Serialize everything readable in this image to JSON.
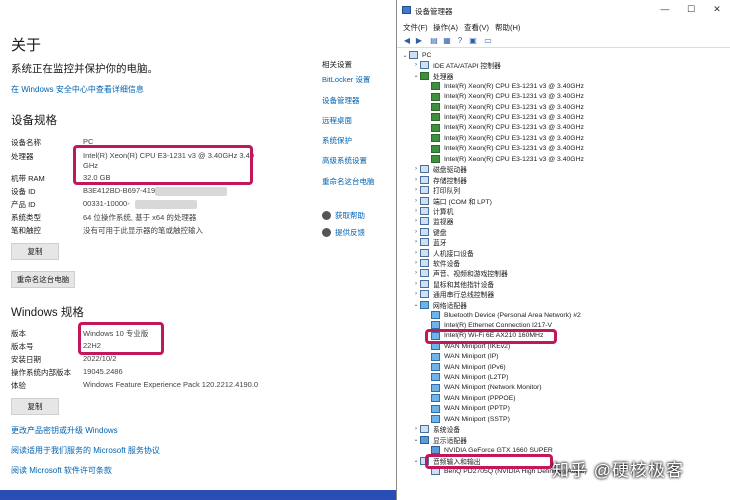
{
  "about": {
    "title": "关于",
    "subtitle": "系统正在监控并保护你的电脑。",
    "security_link": "在 Windows 安全中心中查看详细信息",
    "device_specs_heading": "设备规格",
    "device_specs": [
      {
        "key": "设备名称",
        "value": "PC"
      },
      {
        "key": "处理器",
        "value": "Intel(R) Xeon(R) CPU E3-1231 v3 @ 3.40GHz   3.40"
      },
      {
        "key": "",
        "value": "GHz"
      },
      {
        "key": "机带 RAM",
        "value": "32.0 GB"
      },
      {
        "key": "设备 ID",
        "value": "B3E412BD-B697-4197"
      },
      {
        "key": "产品 ID",
        "value": "00331-10000-"
      },
      {
        "key": "系统类型",
        "value": "64 位操作系统, 基于 x64 的处理器"
      },
      {
        "key": "笔和触控",
        "value": "没有可用于此显示器的笔或触控输入"
      }
    ],
    "copy_button": "复制",
    "rename_button": "重命名这台电脑",
    "windows_specs_heading": "Windows 规格",
    "windows_specs": [
      {
        "key": "版本",
        "value": "Windows 10 专业版"
      },
      {
        "key": "版本号",
        "value": "22H2"
      },
      {
        "key": "安装日期",
        "value": "2022/10/2"
      },
      {
        "key": "操作系统内部版本",
        "value": "19045.2486"
      },
      {
        "key": "体验",
        "value": "Windows Feature Experience Pack 120.2212.4190.0"
      }
    ],
    "copy_button_2": "复制",
    "bottom_links": [
      "更改产品密钥或升级 Windows",
      "阅读适用于我们服务的 Microsoft 服务协议",
      "阅读 Microsoft 软件许可条款"
    ],
    "related_heading": "相关设置",
    "related_links": [
      "BitLocker 设置",
      "设备管理器",
      "远程桌面",
      "系统保护",
      "高级系统设置",
      "重命名这台电脑"
    ],
    "help_links": [
      "获取帮助",
      "提供反馈"
    ],
    "highlight_color": "#c2185b"
  },
  "devmgr": {
    "title": "设备管理器",
    "window_controls": [
      "—",
      "☐",
      "✕"
    ],
    "menu": [
      "文件(F)",
      "操作(A)",
      "查看(V)",
      "帮助(H)"
    ],
    "tree": [
      {
        "depth": 0,
        "exp": "v",
        "label": "PC",
        "icon": "computer"
      },
      {
        "depth": 1,
        "exp": ">",
        "label": "IDE ATA/ATAPI 控制器",
        "icon": "dev"
      },
      {
        "depth": 1,
        "exp": "v",
        "label": "处理器",
        "icon": "chip"
      },
      {
        "depth": 2,
        "exp": "",
        "label": "Intel(R) Xeon(R) CPU E3-1231 v3 @ 3.40GHz",
        "icon": "chip"
      },
      {
        "depth": 2,
        "exp": "",
        "label": "Intel(R) Xeon(R) CPU E3-1231 v3 @ 3.40GHz",
        "icon": "chip"
      },
      {
        "depth": 2,
        "exp": "",
        "label": "Intel(R) Xeon(R) CPU E3-1231 v3 @ 3.40GHz",
        "icon": "chip"
      },
      {
        "depth": 2,
        "exp": "",
        "label": "Intel(R) Xeon(R) CPU E3-1231 v3 @ 3.40GHz",
        "icon": "chip"
      },
      {
        "depth": 2,
        "exp": "",
        "label": "Intel(R) Xeon(R) CPU E3-1231 v3 @ 3.40GHz",
        "icon": "chip"
      },
      {
        "depth": 2,
        "exp": "",
        "label": "Intel(R) Xeon(R) CPU E3-1231 v3 @ 3.40GHz",
        "icon": "chip"
      },
      {
        "depth": 2,
        "exp": "",
        "label": "Intel(R) Xeon(R) CPU E3-1231 v3 @ 3.40GHz",
        "icon": "chip"
      },
      {
        "depth": 2,
        "exp": "",
        "label": "Intel(R) Xeon(R) CPU E3-1231 v3 @ 3.40GHz",
        "icon": "chip"
      },
      {
        "depth": 1,
        "exp": ">",
        "label": "磁盘驱动器",
        "icon": "dev"
      },
      {
        "depth": 1,
        "exp": ">",
        "label": "存储控制器",
        "icon": "dev"
      },
      {
        "depth": 1,
        "exp": ">",
        "label": "打印队列",
        "icon": "dev"
      },
      {
        "depth": 1,
        "exp": ">",
        "label": "端口 (COM 和 LPT)",
        "icon": "dev"
      },
      {
        "depth": 1,
        "exp": ">",
        "label": "计算机",
        "icon": "dev"
      },
      {
        "depth": 1,
        "exp": ">",
        "label": "监视器",
        "icon": "dev"
      },
      {
        "depth": 1,
        "exp": ">",
        "label": "键盘",
        "icon": "dev"
      },
      {
        "depth": 1,
        "exp": ">",
        "label": "蓝牙",
        "icon": "dev"
      },
      {
        "depth": 1,
        "exp": ">",
        "label": "人机接口设备",
        "icon": "dev"
      },
      {
        "depth": 1,
        "exp": ">",
        "label": "软件设备",
        "icon": "dev"
      },
      {
        "depth": 1,
        "exp": ">",
        "label": "声音、视频和游戏控制器",
        "icon": "dev"
      },
      {
        "depth": 1,
        "exp": ">",
        "label": "鼠标和其他指针设备",
        "icon": "dev"
      },
      {
        "depth": 1,
        "exp": ">",
        "label": "通用串行总线控制器",
        "icon": "dev"
      },
      {
        "depth": 1,
        "exp": "v",
        "label": "网络适配器",
        "icon": "net"
      },
      {
        "depth": 2,
        "exp": "",
        "label": "Bluetooth Device (Personal Area Network) #2",
        "icon": "net"
      },
      {
        "depth": 2,
        "exp": "",
        "label": "Intel(R) Ethernet Connection I217-V",
        "icon": "net"
      },
      {
        "depth": 2,
        "exp": "",
        "label": "Intel(R) Wi-Fi 6E AX210 160MHz",
        "icon": "net"
      },
      {
        "depth": 2,
        "exp": "",
        "label": "WAN Miniport (IKEv2)",
        "icon": "net"
      },
      {
        "depth": 2,
        "exp": "",
        "label": "WAN Miniport (IP)",
        "icon": "net"
      },
      {
        "depth": 2,
        "exp": "",
        "label": "WAN Miniport (IPv6)",
        "icon": "net"
      },
      {
        "depth": 2,
        "exp": "",
        "label": "WAN Miniport (L2TP)",
        "icon": "net"
      },
      {
        "depth": 2,
        "exp": "",
        "label": "WAN Miniport (Network Monitor)",
        "icon": "net"
      },
      {
        "depth": 2,
        "exp": "",
        "label": "WAN Miniport (PPPOE)",
        "icon": "net"
      },
      {
        "depth": 2,
        "exp": "",
        "label": "WAN Miniport (PPTP)",
        "icon": "net"
      },
      {
        "depth": 2,
        "exp": "",
        "label": "WAN Miniport (SSTP)",
        "icon": "net"
      },
      {
        "depth": 1,
        "exp": ">",
        "label": "系统设备",
        "icon": "dev"
      },
      {
        "depth": 1,
        "exp": "v",
        "label": "显示适配器",
        "icon": "disp"
      },
      {
        "depth": 2,
        "exp": "",
        "label": "NVIDIA GeForce GTX 1660 SUPER",
        "icon": "disp"
      },
      {
        "depth": 1,
        "exp": "v",
        "label": "音频输入和输出",
        "icon": "dev"
      },
      {
        "depth": 2,
        "exp": "",
        "label": "BenQ PD2705Q (NVIDIA High Definition Audio)",
        "icon": "dev"
      }
    ]
  },
  "watermark": "知乎 @硬核极客"
}
